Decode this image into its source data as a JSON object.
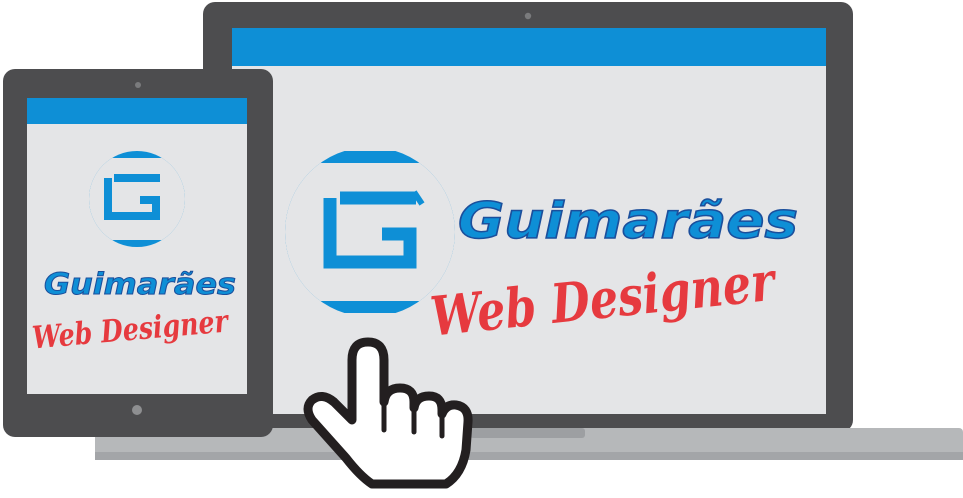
{
  "brand": {
    "name": "Guimarães",
    "tagline": "Web Designer"
  },
  "colors": {
    "device_frame": "#4d4d4f",
    "screen_bg": "#e4e5e7",
    "accent_blue": "#0e8fd6",
    "brand_dark_blue": "#1b4f9c",
    "tagline_red": "#e63a3f",
    "laptop_base": "#b6b8ba",
    "cursor_outline": "#231f20"
  },
  "icons": {
    "logo": "g-square-logo-icon",
    "pointer": "hand-pointer-cursor-icon"
  }
}
